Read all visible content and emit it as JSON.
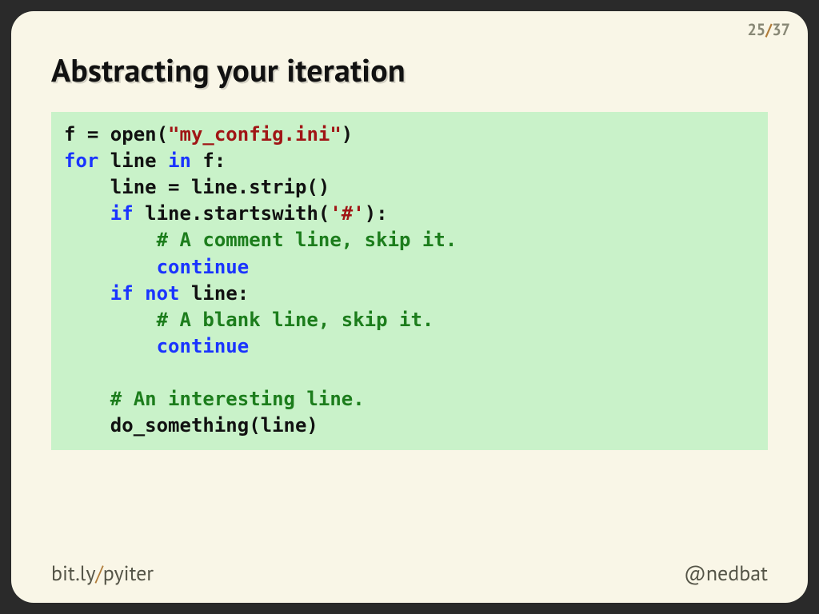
{
  "page": {
    "current": "25",
    "sep": "/",
    "total": "37"
  },
  "title": "Abstracting your iteration",
  "code": {
    "l1a": "f = open(",
    "l1b": "\"my_config.ini\"",
    "l1c": ")",
    "l2a": "for",
    "l2b": " line ",
    "l2c": "in",
    "l2d": " f:",
    "l3": "    line = line.strip()",
    "l4a": "    ",
    "l4b": "if",
    "l4c": " line.startswith(",
    "l4d": "'#'",
    "l4e": "):",
    "l5": "        # A comment line, skip it.",
    "l6a": "        ",
    "l6b": "continue",
    "l7a": "    ",
    "l7b": "if",
    "l7c": " ",
    "l7d": "not",
    "l7e": " line:",
    "l8": "        # A blank line, skip it.",
    "l9a": "        ",
    "l9b": "continue",
    "blank": "",
    "l11": "    # An interesting line.",
    "l12": "    do_something(line)"
  },
  "footer": {
    "url_pre": "bit.ly",
    "url_sep": "/",
    "url_post": "pyiter",
    "handle": "@nedbat"
  }
}
